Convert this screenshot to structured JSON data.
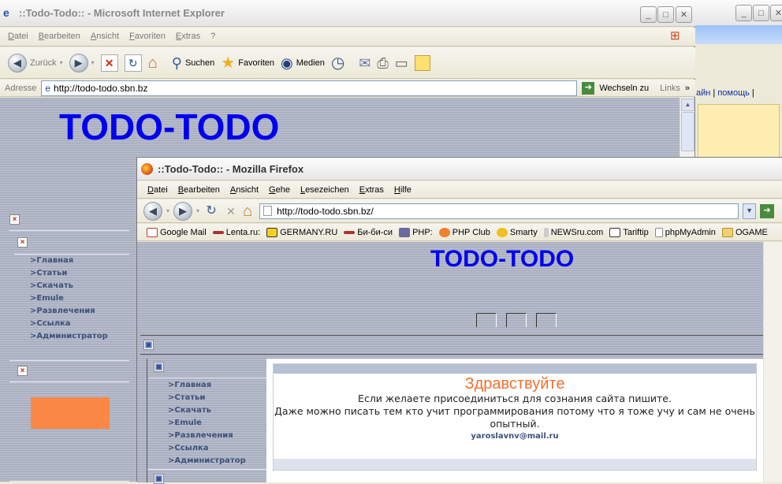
{
  "ie": {
    "title": "::Todo-Todo:: - Microsoft Internet Explorer",
    "menu": [
      "Datei",
      "Bearbeiten",
      "Ansicht",
      "Favoriten",
      "Extras",
      "?"
    ],
    "toolbar": {
      "back": "Zurück",
      "search": "Suchen",
      "favorites": "Favoriten",
      "media": "Medien"
    },
    "address_label": "Adresse",
    "address": "http://todo-todo.sbn.bz",
    "go": "Wechseln zu",
    "links": "Links",
    "page_title": "TODO-TODO",
    "nav": [
      ">Главная",
      ">Статьи",
      ">Скачать",
      ">Emule",
      ">Развлечения",
      ">Ссылка",
      ">Администратор"
    ]
  },
  "bg_window": {
    "links_text": "айн",
    "help_text": "помощь"
  },
  "ff": {
    "title": "::Todo-Todo:: - Mozilla Firefox",
    "menu": [
      "Datei",
      "Bearbeiten",
      "Ansicht",
      "Gehe",
      "Lesezeichen",
      "Extras",
      "Hilfe"
    ],
    "address": "http://todo-todo.sbn.bz/",
    "bookmarks": [
      "Google Mail",
      "Lenta.ru:",
      "GERMANY.RU",
      "Би-би-си",
      "PHP:",
      "PHP Club",
      "Smarty",
      "NEWSru.com",
      "Tariftip",
      "phpMyAdmin",
      "OGAME"
    ],
    "page_title": "TODO-TODO",
    "nav": [
      ">Главная",
      ">Статьи",
      ">Скачать",
      ">Emule",
      ">Развлечения",
      ">Ссылка",
      ">Администратор"
    ],
    "welcome": {
      "heading": "Здравствуйте",
      "line1": "Если желаете присоединиться для сознания сайта пишите.",
      "line2": "Даже можно писать тем кто учит программирования потому что я тоже учу и сам не очень опытный.",
      "email": "yaroslavnv@mail.ru"
    }
  },
  "colors": {
    "title_blue": "#0000ee",
    "welcome_orange": "#f07030",
    "orange_block": "#fb8844"
  }
}
